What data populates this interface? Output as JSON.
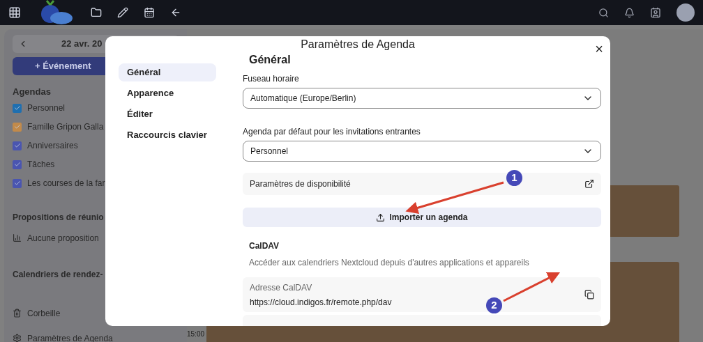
{
  "sidebar": {
    "date": "22 avr. 20",
    "new_event": "+ Événement",
    "agendas_title": "Agendas",
    "agendas": [
      {
        "label": "Personnel",
        "checked": true,
        "color": "#1f6fb0"
      },
      {
        "label": "Famille Gripon Galla",
        "checked": true,
        "color": "#c28a4a"
      },
      {
        "label": "Anniversaires",
        "checked": true,
        "color": "#4a55b0"
      },
      {
        "label": "Tâches",
        "checked": true,
        "color": "#4a55b0"
      },
      {
        "label": "Les courses de la far",
        "checked": true,
        "color": "#4a55b0"
      }
    ],
    "proposals_title": "Propositions de réunio",
    "proposals_empty": "Aucune proposition",
    "booking_title": "Calendriers de rendez-",
    "trash": "Corbeille",
    "settings": "Paramètres de Agenda"
  },
  "calendar": {
    "time": "15:00"
  },
  "dialog": {
    "title": "Paramètres de Agenda",
    "close": "×",
    "nav": [
      {
        "label": "Général",
        "selected": true
      },
      {
        "label": "Apparence",
        "selected": false
      },
      {
        "label": "Éditer",
        "selected": false
      },
      {
        "label": "Raccourcis clavier",
        "selected": false
      }
    ],
    "heading": "Général",
    "timezone_label": "Fuseau horaire",
    "timezone_value": "Automatique (Europe/Berlin)",
    "default_label": "Agenda par défaut pour les invitations entrantes",
    "default_value": "Personnel",
    "availability": "Paramètres de disponibilité",
    "import": "Importer un agenda",
    "caldav_title": "CalDAV",
    "caldav_desc": "Accéder aux calendriers Nextcloud depuis d'autres applications et appareils",
    "caldav_address_label": "Adresse CalDAV",
    "caldav_address": "https://cloud.indigos.fr/remote.php/dav"
  },
  "annotations": [
    {
      "number": "1"
    },
    {
      "number": "2"
    }
  ]
}
